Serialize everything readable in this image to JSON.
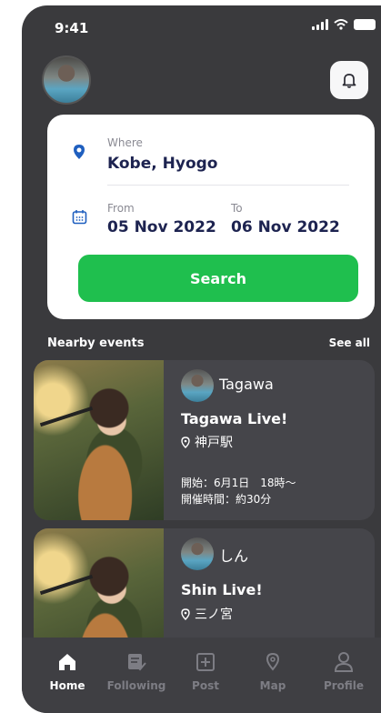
{
  "status_bar": {
    "time": "9:41"
  },
  "search": {
    "where_label": "Where",
    "where_value": "Kobe, Hyogo",
    "from_label": "From",
    "from_value": "05 Nov 2022",
    "to_label": "To",
    "to_value": "06 Nov 2022",
    "button_label": "Search"
  },
  "nearby": {
    "heading": "Nearby events",
    "see_all": "See all",
    "events": [
      {
        "host": "Tagawa",
        "title": "Tagawa Live!",
        "location": "神戸駅",
        "info_line1": "開始：6月1日　18時〜",
        "info_line2": "開催時間：約30分"
      },
      {
        "host": "しん",
        "title": "Shin Live!",
        "location": "三ノ宮"
      }
    ]
  },
  "tabs": [
    {
      "label": "Home",
      "icon": "home-icon",
      "active": true
    },
    {
      "label": "Following",
      "icon": "following-icon",
      "active": false
    },
    {
      "label": "Post",
      "icon": "post-icon",
      "active": false
    },
    {
      "label": "Map",
      "icon": "map-pin-icon",
      "active": false
    },
    {
      "label": "Profile",
      "icon": "profile-icon",
      "active": false
    }
  ],
  "colors": {
    "background": "#3a3a3d",
    "card": "#45454a",
    "accent_green": "#1fbf4e",
    "accent_blue": "#1f5fbf",
    "navy_text": "#1d2350"
  }
}
